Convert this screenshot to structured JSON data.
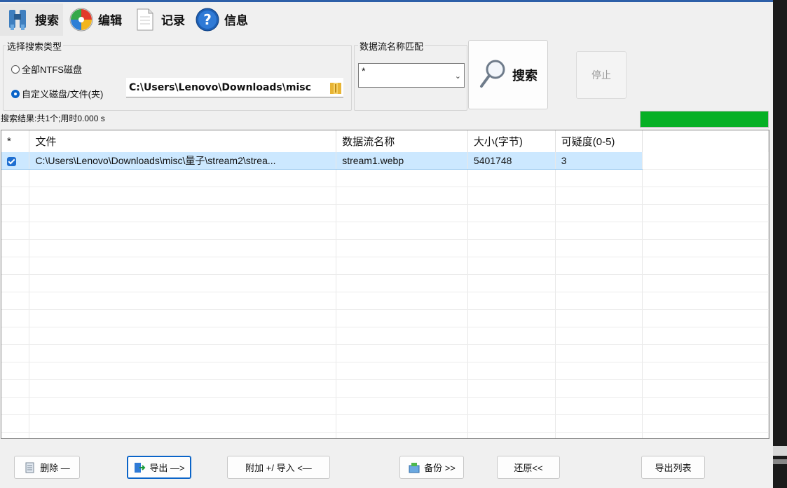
{
  "toolbar": {
    "items": [
      {
        "label": "搜索",
        "icon": "search-binoculars-icon",
        "active": true
      },
      {
        "label": "编辑",
        "icon": "edit-pinwheel-icon"
      },
      {
        "label": "记录",
        "icon": "document-icon"
      },
      {
        "label": "信息",
        "icon": "help-icon"
      }
    ]
  },
  "search_type": {
    "title": "选择搜索类型",
    "option_all": "全部NTFS磁盘",
    "option_custom": "自定义磁盘/文件(夹)",
    "path_value": "C:\\Users\\Lenovo\\Downloads\\misc"
  },
  "stream_match": {
    "title": "数据流名称匹配",
    "value": "*"
  },
  "buttons": {
    "search": "搜索",
    "stop": "停止",
    "delete": "删除 —",
    "export": "导出 —>",
    "attach_import": "附加 +/ 导入 <—",
    "backup": "备份 >>",
    "restore": "还原<<",
    "export_list": "导出列表"
  },
  "status": {
    "text": "搜索结果:共1个;用时0.000 s",
    "progress_fraction": 1.0,
    "progress_color": "#06b025"
  },
  "table": {
    "headers": [
      "*",
      "文件",
      "数据流名称",
      "大小(字节)",
      "可疑度(0-5)"
    ],
    "rows": [
      {
        "checked": true,
        "file": "C:\\Users\\Lenovo\\Downloads\\misc\\量子\\stream2\\strea...",
        "stream": "stream1.webp",
        "size": "5401748",
        "suspicion": "3"
      }
    ]
  }
}
